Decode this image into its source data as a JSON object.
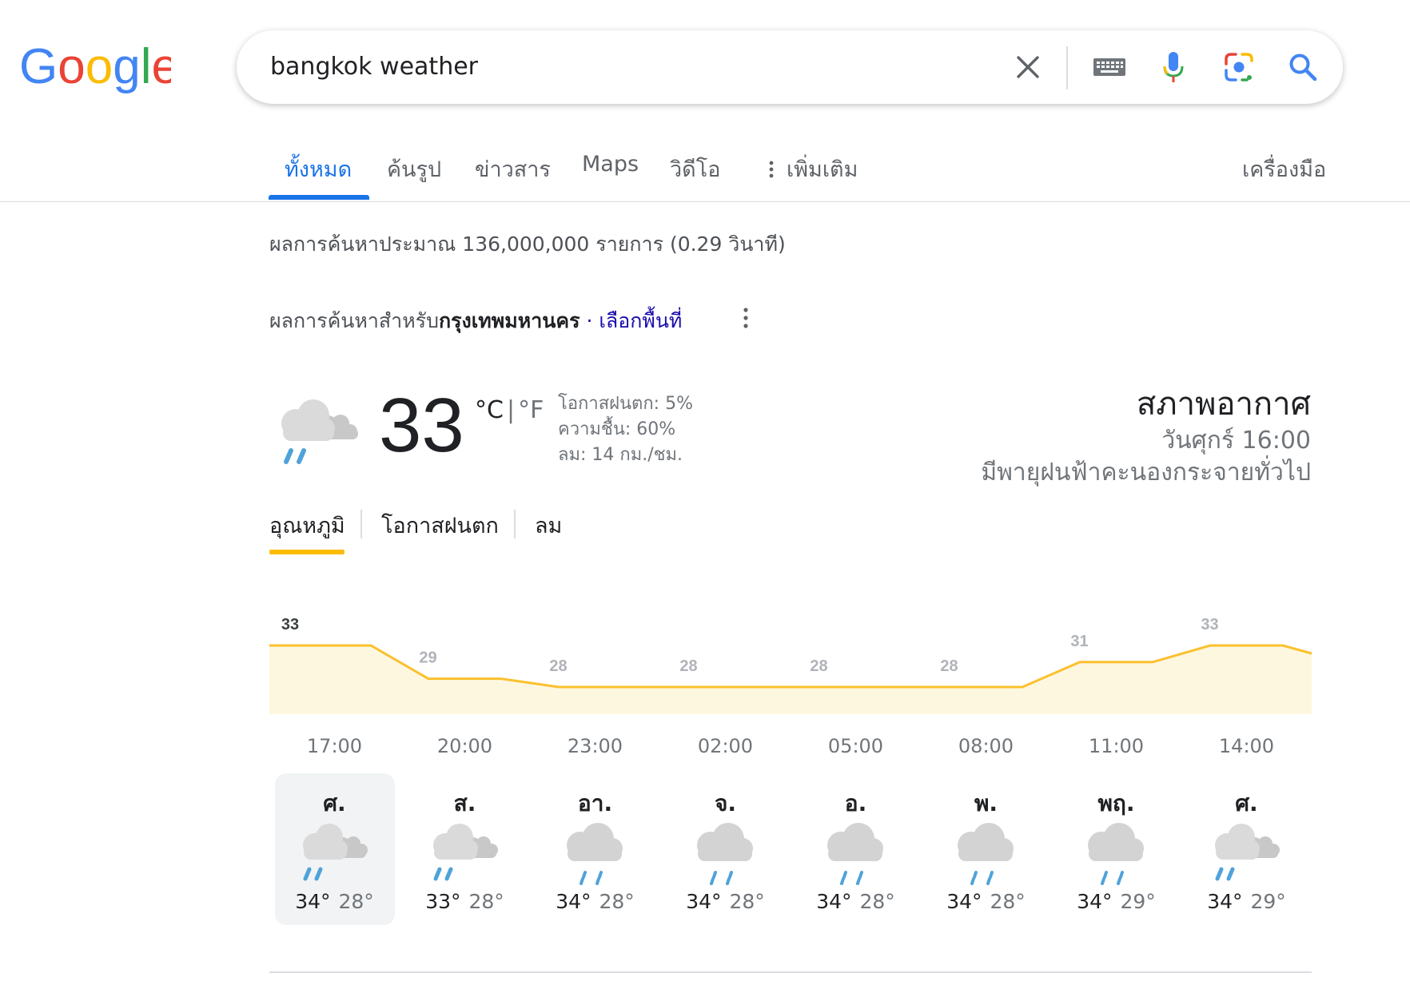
{
  "logo": {
    "text": "Google",
    "colors": [
      "#4285f4",
      "#ea4335",
      "#fbbc04",
      "#4285f4",
      "#34a853",
      "#ea4335"
    ]
  },
  "search": {
    "query": "bangkok weather",
    "icons": [
      "close-icon",
      "keyboard-icon",
      "microphone-icon",
      "camera-lens-icon",
      "search-icon"
    ]
  },
  "tabs": [
    {
      "label": "ทั้งหมด",
      "active": true
    },
    {
      "label": "ค้นรูป"
    },
    {
      "label": "ข่าวสาร"
    },
    {
      "label": "Maps"
    },
    {
      "label": "วิดีโอ"
    },
    {
      "label": "เพิ่มเติม"
    },
    {
      "label": "เครื่องมือ"
    }
  ],
  "result_stats": "ผลการค้นหาประมาณ 136,000,000 รายการ (0.29 วินาที)",
  "location": {
    "prefix": "ผลการค้นหาสำหรับ",
    "place": "กรุงเทพมหานคร",
    "separator": " · ",
    "link": "เลือกพื้นที่"
  },
  "weather": {
    "temp": "33",
    "unit_c": "°C",
    "unit_sep": "|",
    "unit_f": "°F",
    "precip": "โอกาสฝนตก: 5%",
    "humidity": "ความชื้น: 60%",
    "wind": "ลม: 14 กม./ชม.",
    "title": "สภาพอากาศ",
    "time": "วันศุกร์ 16:00",
    "desc": "มีพายุฝนฟ้าคะนองกระจายทั่วไป",
    "icon": "scattered-thunderstorm-icon"
  },
  "subtabs": [
    {
      "label": "อุณหภูมิ",
      "active": true
    },
    {
      "label": "โอกาสฝนตก"
    },
    {
      "label": "ลม"
    }
  ],
  "chart_data": {
    "type": "area",
    "x": [
      "17:00",
      "20:00",
      "23:00",
      "02:00",
      "05:00",
      "08:00",
      "11:00",
      "14:00"
    ],
    "values": [
      33,
      29,
      28,
      28,
      28,
      28,
      31,
      33
    ],
    "ylabel": "",
    "fill_color": "#fef7e0",
    "line_color": "#fbc02d"
  },
  "days": [
    {
      "name": "ศ.",
      "hi": "34°",
      "lo": "28°",
      "icon": "scattered-thunderstorm-icon",
      "selected": true
    },
    {
      "name": "ส.",
      "hi": "33°",
      "lo": "28°",
      "icon": "scattered-thunderstorm-icon"
    },
    {
      "name": "อา.",
      "hi": "34°",
      "lo": "28°",
      "icon": "thunderstorm-icon"
    },
    {
      "name": "จ.",
      "hi": "34°",
      "lo": "28°",
      "icon": "thunderstorm-icon"
    },
    {
      "name": "อ.",
      "hi": "34°",
      "lo": "28°",
      "icon": "thunderstorm-icon"
    },
    {
      "name": "พ.",
      "hi": "34°",
      "lo": "28°",
      "icon": "thunderstorm-icon"
    },
    {
      "name": "พฤ.",
      "hi": "34°",
      "lo": "29°",
      "icon": "thunderstorm-icon"
    },
    {
      "name": "ศ.",
      "hi": "34°",
      "lo": "29°",
      "icon": "scattered-thunderstorm-icon"
    }
  ]
}
